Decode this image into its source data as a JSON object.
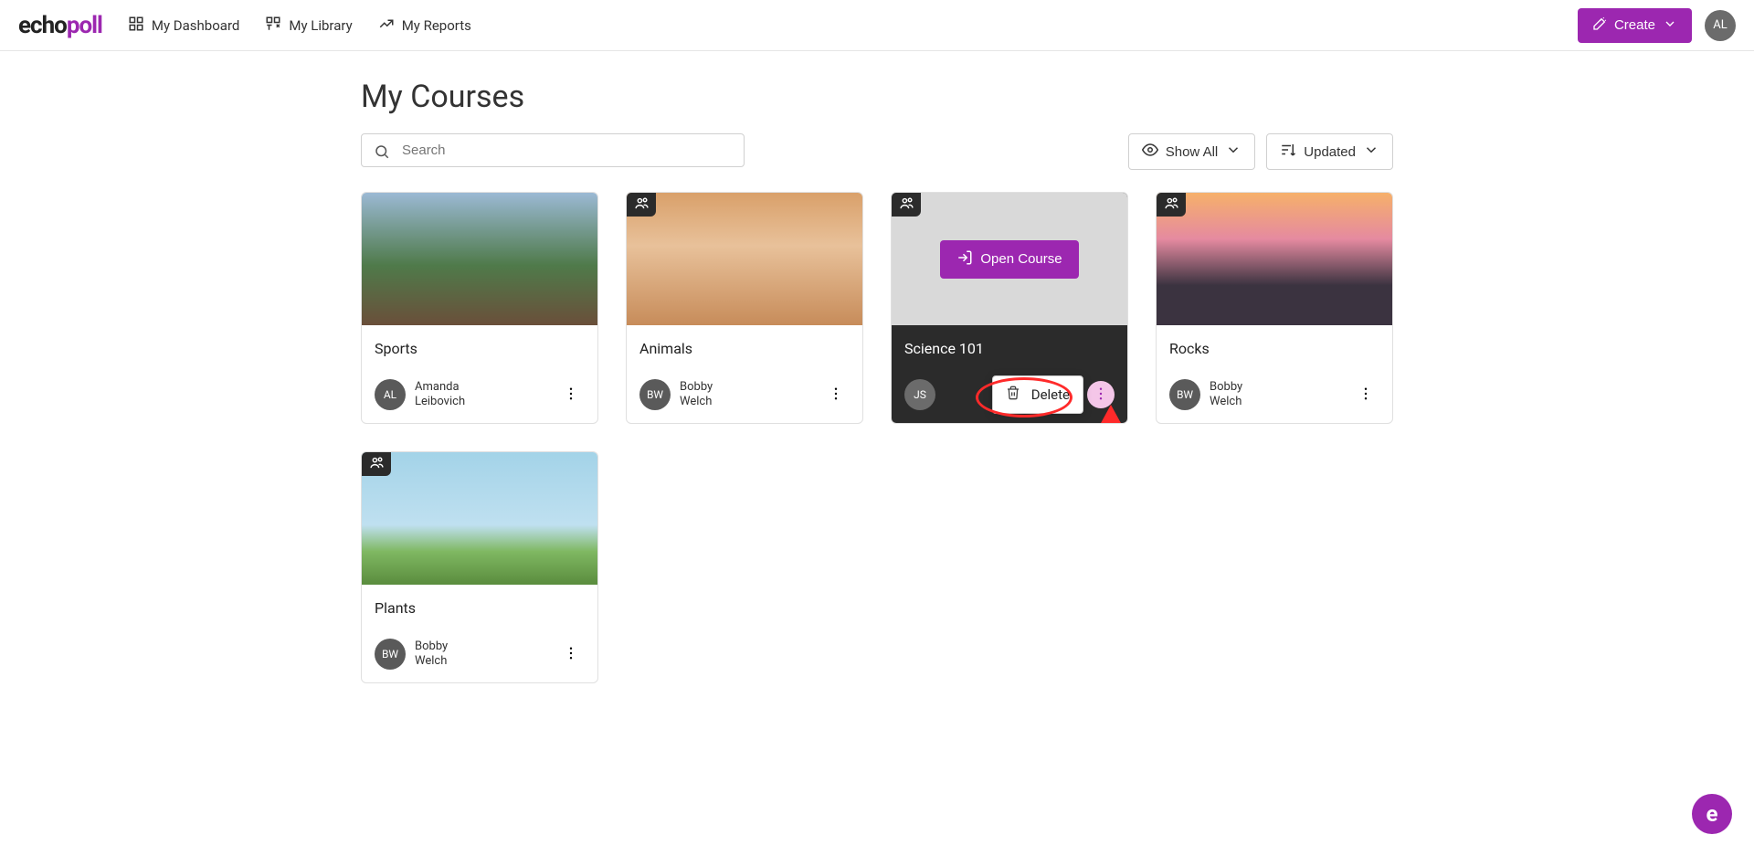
{
  "brand": {
    "part1": "echo",
    "part2": "poll"
  },
  "nav": {
    "dashboard": "My Dashboard",
    "library": "My Library",
    "reports": "My Reports"
  },
  "createLabel": "Create",
  "userInitials": "AL",
  "pageTitle": "My Courses",
  "search": {
    "placeholder": "Search"
  },
  "filters": {
    "visibility": "Show All",
    "sort": "Updated"
  },
  "openCourseLabel": "Open Course",
  "menu": {
    "delete": "Delete"
  },
  "courses": [
    {
      "title": "Sports",
      "ownerInitials": "AL",
      "ownerFirst": "Amanda",
      "ownerLast": "Leibovich",
      "shared": false,
      "active": false,
      "thumbClass": "sports"
    },
    {
      "title": "Animals",
      "ownerInitials": "BW",
      "ownerFirst": "Bobby",
      "ownerLast": "Welch",
      "shared": true,
      "active": false,
      "thumbClass": "animals"
    },
    {
      "title": "Science 101",
      "ownerInitials": "JS",
      "ownerFirst": "",
      "ownerLast": "",
      "shared": true,
      "active": true,
      "thumbClass": ""
    },
    {
      "title": "Rocks",
      "ownerInitials": "BW",
      "ownerFirst": "Bobby",
      "ownerLast": "Welch",
      "shared": true,
      "active": false,
      "thumbClass": "rocks"
    },
    {
      "title": "Plants",
      "ownerInitials": "BW",
      "ownerFirst": "Bobby",
      "ownerLast": "Welch",
      "shared": true,
      "active": false,
      "thumbClass": "plants"
    }
  ],
  "fabLabel": "e"
}
